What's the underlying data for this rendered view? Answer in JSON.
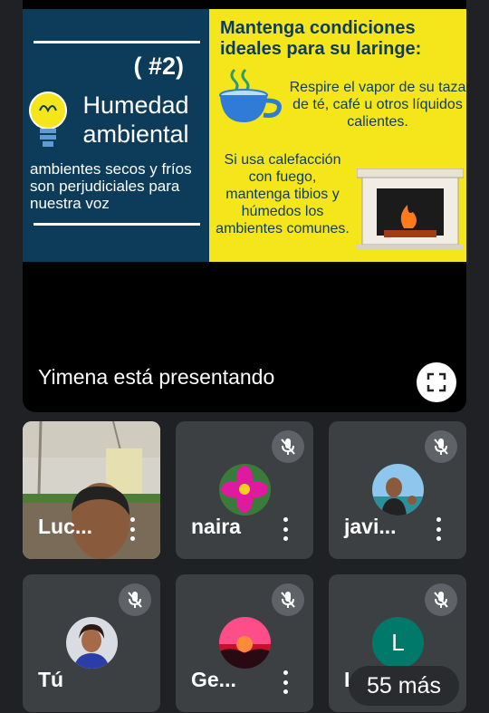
{
  "slide": {
    "number": "( #2)",
    "heading_line1": "Humedad",
    "heading_line2": "ambiental",
    "description": "ambientes secos y fríos son perjudiciales para nuestra voz",
    "right_title": "Mantenga condiciones ideales para su laringe:",
    "tip1": "Respire el vapor de su taza de té, café u otros líquidos calientes.",
    "tip2": "Si usa calefacción con fuego, mantenga tibios y húmedos los ambientes comunes."
  },
  "presenting_text": "Yimena está presentando",
  "participants": [
    {
      "name": "Luc...",
      "muted": false
    },
    {
      "name": "naira",
      "muted": true
    },
    {
      "name": "javi...",
      "muted": true
    },
    {
      "name": "Tú",
      "muted": true
    },
    {
      "name": "Ge...",
      "muted": true
    },
    {
      "name": "Li...",
      "initial": "L",
      "muted": true
    }
  ],
  "more_count": "55 más",
  "colors": {
    "slide_left": "#0d3b5a",
    "slide_right": "#f5e61c",
    "tile_bg": "#3c4043",
    "avatar_l": "#00796b"
  }
}
